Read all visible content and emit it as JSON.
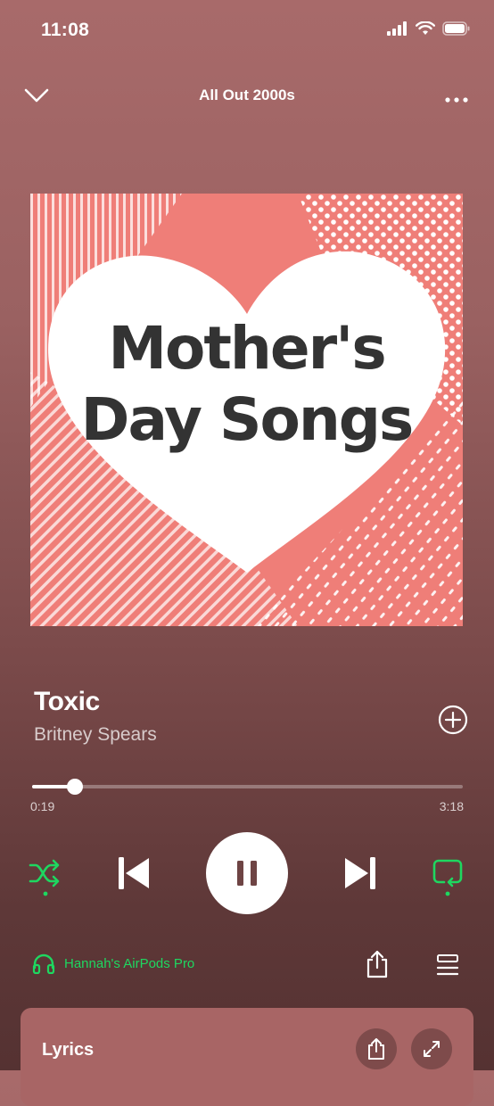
{
  "status": {
    "time": "11:08"
  },
  "header": {
    "title": "All Out 2000s"
  },
  "artwork": {
    "line1": "Mother's",
    "line2": "Day Songs"
  },
  "track": {
    "title": "Toxic",
    "artist": "Britney Spears"
  },
  "progress": {
    "elapsed": "0:19",
    "duration": "3:18",
    "fraction": 0.1
  },
  "device": {
    "name": "Hannah's AirPods Pro"
  },
  "lyrics": {
    "label": "Lyrics"
  },
  "colors": {
    "accent": "#1ed760",
    "art_bg": "#ef7e78"
  }
}
